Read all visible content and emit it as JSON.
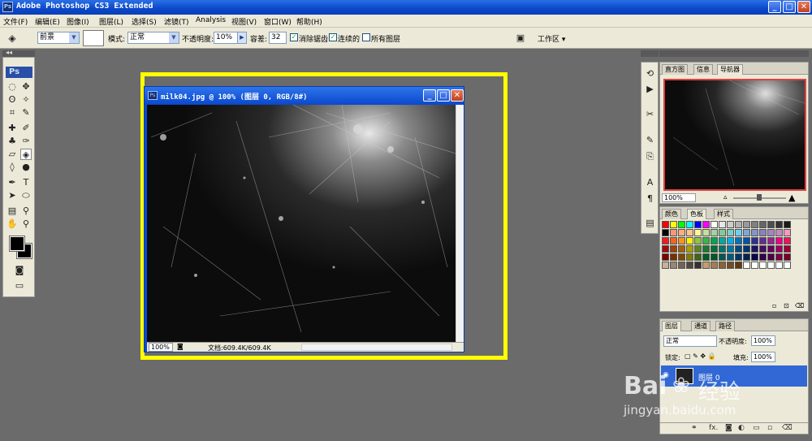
{
  "app": {
    "title": "Adobe Photoshop CS3 Extended",
    "icon": "ps-icon",
    "window_buttons": [
      "_",
      "□",
      "✕"
    ]
  },
  "menubar": {
    "items": [
      "文件(F)",
      "编辑(E)",
      "图像(I)",
      "图层(L)",
      "选择(S)",
      "滤镜(T)",
      "Analysis",
      "视图(V)",
      "窗口(W)",
      "帮助(H)"
    ]
  },
  "options_bar": {
    "fill_label": "前景",
    "mode_label": "模式:",
    "mode_value": "正常",
    "opacity_label": "不透明度:",
    "opacity_value": "10%",
    "tolerance_label": "容差:",
    "tolerance_value": "32",
    "anti_alias_label": "消除锯齿",
    "anti_alias_checked": true,
    "contiguous_label": "连续的",
    "contiguous_checked": true,
    "all_layers_label": "所有图层",
    "all_layers_checked": false,
    "workspace_label": "工作区 ▾",
    "check_mark": "✓"
  },
  "tools": {
    "logo": "Ps",
    "items": [
      "marquee",
      "move",
      "lasso",
      "magic-wand",
      "crop",
      "slice",
      "heal",
      "brush",
      "stamp",
      "history-brush",
      "eraser",
      "paint-bucket",
      "blur",
      "dodge",
      "pen",
      "type",
      "path-select",
      "shape",
      "notes",
      "eyedropper",
      "hand",
      "zoom"
    ],
    "foreground_color": "#000000",
    "background_color": "#000000"
  },
  "document": {
    "title": "milk04.jpg @ 100% (图层 0, RGB/8#)",
    "zoom": "100%",
    "info": "文档:609.4K/609.4K",
    "highlight_color": "#ffff00"
  },
  "navigator_panel": {
    "tabs": [
      "直方图",
      "信息",
      "导航器"
    ],
    "active_tab": "导航器",
    "zoom": "100%"
  },
  "swatches_panel": {
    "tabs": [
      "颜色",
      "色板",
      "样式"
    ],
    "active_tab": "色板",
    "colors": [
      "#ff0000",
      "#ffff00",
      "#00ff00",
      "#00ffff",
      "#0000ff",
      "#ff00ff",
      "#ffffff",
      "#e6e6e6",
      "#cccccc",
      "#b3b3b3",
      "#999999",
      "#808080",
      "#666666",
      "#4d4d4d",
      "#333333",
      "#1a1a1a",
      "#000000",
      "#f7977a",
      "#f9ad81",
      "#fdc68a",
      "#fff79a",
      "#c4df9b",
      "#a2d39c",
      "#82ca9d",
      "#7bcdc8",
      "#6ecff6",
      "#7ea7d8",
      "#8493ca",
      "#8882be",
      "#a187be",
      "#bc8dbf",
      "#f49ac2",
      "#ed1c24",
      "#f26522",
      "#f7941d",
      "#fff200",
      "#8dc63f",
      "#39b54a",
      "#00a651",
      "#00a99d",
      "#00aeef",
      "#0072bc",
      "#0054a6",
      "#2e3192",
      "#662d91",
      "#92278f",
      "#ec008c",
      "#ed145b",
      "#9e0b0f",
      "#a0410d",
      "#a36209",
      "#aba000",
      "#598527",
      "#1a7b30",
      "#007236",
      "#00746b",
      "#0076a3",
      "#004a80",
      "#003471",
      "#1b1464",
      "#440e62",
      "#630460",
      "#9e005d",
      "#9e0039",
      "#790000",
      "#7b2e00",
      "#7d4900",
      "#827b00",
      "#406618",
      "#005e20",
      "#005826",
      "#005952",
      "#005b7f",
      "#003663",
      "#002157",
      "#0d004c",
      "#32004b",
      "#4b0049",
      "#7b0046",
      "#7a0026",
      "#c7b299",
      "#998675",
      "#736357",
      "#534741",
      "#37302d",
      "#c69c6d",
      "#a67c52",
      "#8c6239",
      "#754c24",
      "#603913",
      "#ffffff",
      "#ffffff",
      "#ffffff",
      "#ffffff",
      "#ffffff",
      "#ffffff"
    ]
  },
  "layers_panel": {
    "tabs": [
      "图层",
      "通道",
      "路径"
    ],
    "active_tab": "图层",
    "blend_mode": "正常",
    "opacity_label": "不透明度:",
    "opacity_value": "100%",
    "lock_label": "锁定:",
    "fill_label": "填充:",
    "fill_value": "100%",
    "layer_name": "图层 0",
    "footer_icons": [
      "link-icon",
      "fx-icon",
      "mask-icon",
      "adjustment-icon",
      "group-icon",
      "new-layer-icon",
      "trash-icon"
    ]
  },
  "watermark": {
    "brand": "Bai",
    "brand_tail": "经验",
    "url": "jingyan.baidu.com"
  }
}
